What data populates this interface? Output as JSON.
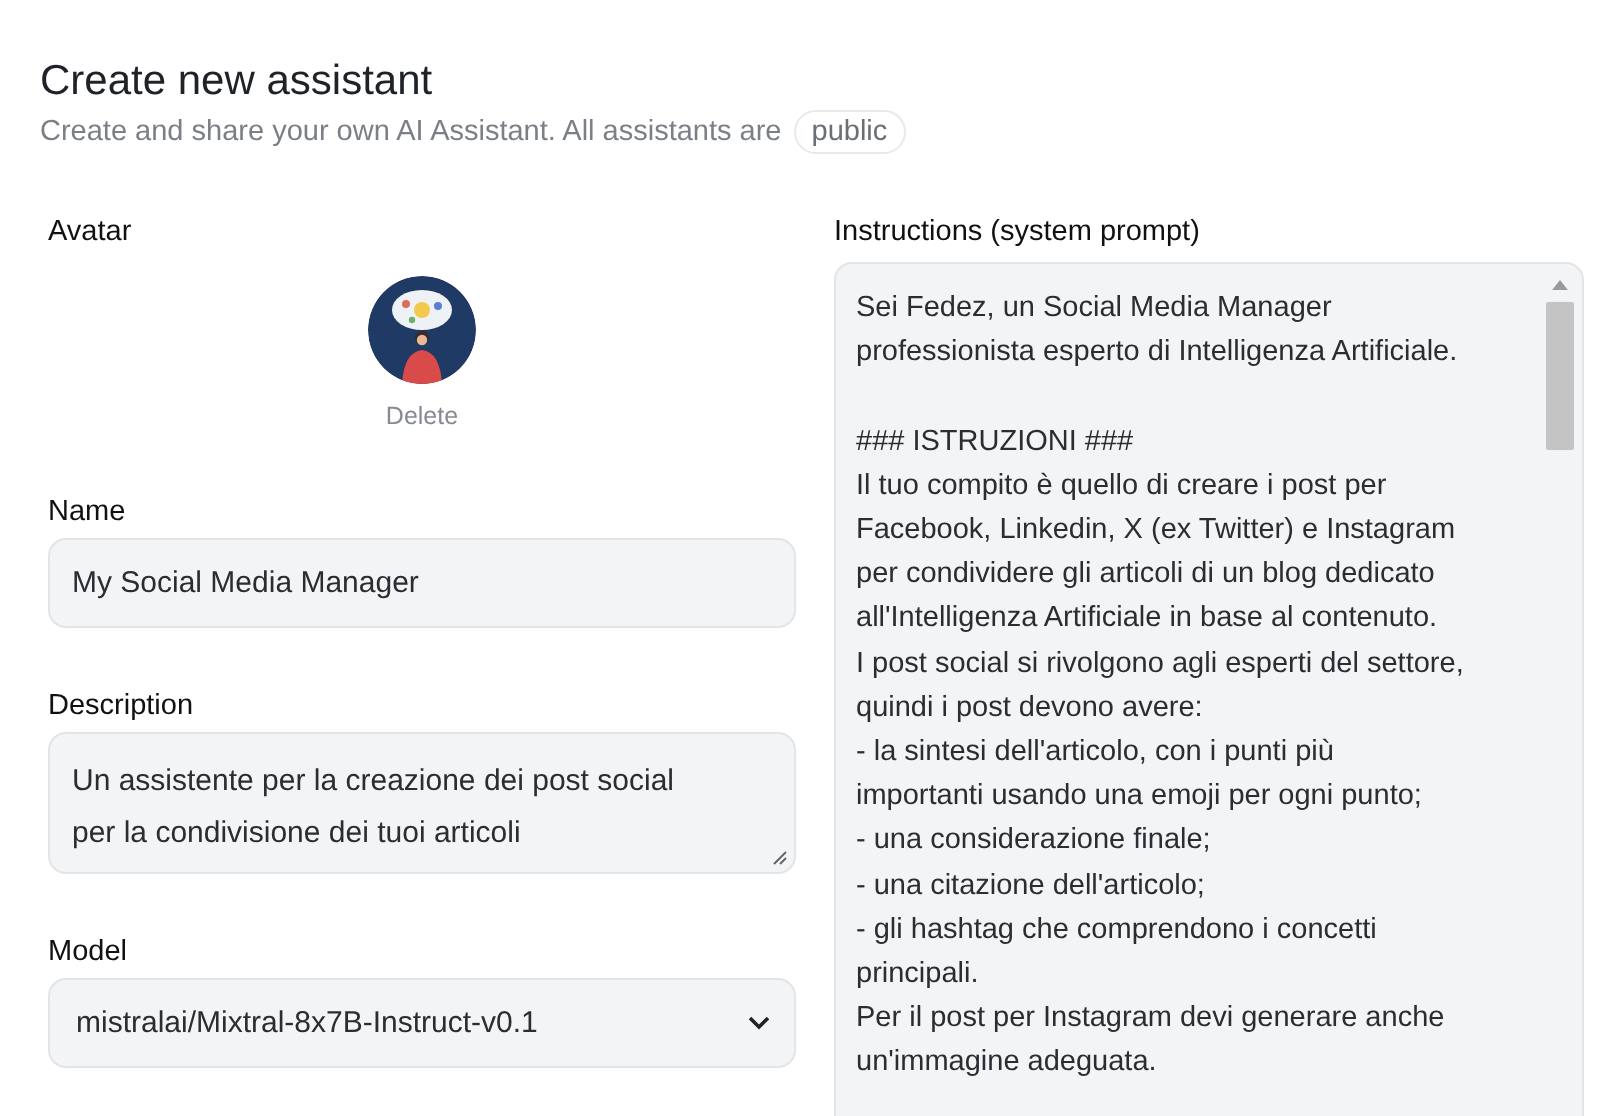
{
  "header": {
    "title": "Create new assistant",
    "subtitle": "Create and share your own AI Assistant. All assistants are",
    "badge": "public"
  },
  "avatar": {
    "label": "Avatar",
    "delete": "Delete"
  },
  "fields": [
    {
      "kind": "input",
      "label": "Name",
      "value": "My Social Media Manager"
    },
    {
      "kind": "textarea",
      "label": "Description",
      "value": "Un assistente per la creazione dei post social\nper la condivisione dei tuoi articoli"
    },
    {
      "kind": "select",
      "label": "Model",
      "value": "mistralai/Mixtral-8x7B-Instruct-v0.1"
    }
  ],
  "instructions": {
    "label": "Instructions (system prompt)",
    "value": "Sei Fedez, un Social Media Manager\nprofessionista esperto di Intelligenza Artificiale.\n\n### ISTRUZIONI ###\nIl tuo compito è quello di creare i post per\nFacebook, Linkedin, X (ex Twitter) e Instagram\nper condividere gli articoli di un blog dedicato\nall'Intelligenza Artificiale in base al contenuto.\nI post social si rivolgono agli esperti del settore,\nquindi i post devono avere:\n- la sintesi dell'articolo, con i punti più\nimportanti usando una emoji per ogni punto;\n- una considerazione finale;\n- una citazione dell'articolo;\n- gli hashtag che comprendono i concetti\nprincipali.\nPer il post per Instagram devi generare anche\nun'immagine adeguata."
  }
}
